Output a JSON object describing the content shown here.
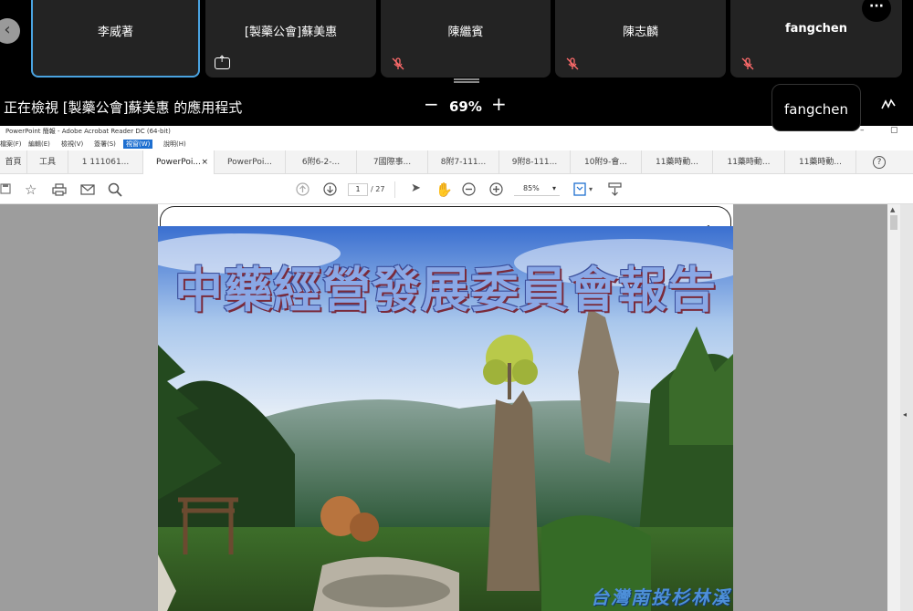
{
  "participants": [
    {
      "name": "李威著",
      "icon": "none"
    },
    {
      "name": "[製藥公會]蘇美惠",
      "icon": "share-screen-icon"
    },
    {
      "name": "陳繼賓",
      "icon": "mic-off-icon"
    },
    {
      "name": "陳志麟",
      "icon": "mic-off-icon"
    },
    {
      "name": "fangchen",
      "icon": "mic-off-icon"
    }
  ],
  "more_label": "···",
  "viewing": {
    "label": "正在檢視 [製藥公會]蘇美惠 的應用程式",
    "zoom": "69%",
    "minus": "−",
    "plus": "+"
  },
  "active_speaker": "fangchen",
  "acrobat": {
    "title": "PowerPoint 簡報 - Adobe Acrobat Reader DC (64-bit)",
    "menu": [
      "檔案(F)",
      "編輯(E)",
      "檢視(V)",
      "簽署(S)",
      "視窗(W)",
      "說明(H)"
    ],
    "tabs": [
      "首頁",
      "工具",
      "1 111061...",
      "PowerPoi...",
      "PowerPoi...",
      "6附6-2-...",
      "7國際事...",
      "8附7-111...",
      "9附8-111...",
      "10附9-會...",
      "11藥時動...",
      "11藥時動...",
      "11藥時動..."
    ],
    "tab_close": "×",
    "help": "?",
    "page_current": "1",
    "page_total": "/ 27",
    "zoom": "85%",
    "zoom_caret": "▾"
  },
  "page_number": "1",
  "slide": {
    "title": "中藥經營發展委員會報告",
    "caption": "台灣南投杉林溪"
  },
  "colors": {
    "active_border": "#4aa3e0",
    "menu_selected": "#1e6fd0",
    "title_fill": "#8aa8e6"
  }
}
